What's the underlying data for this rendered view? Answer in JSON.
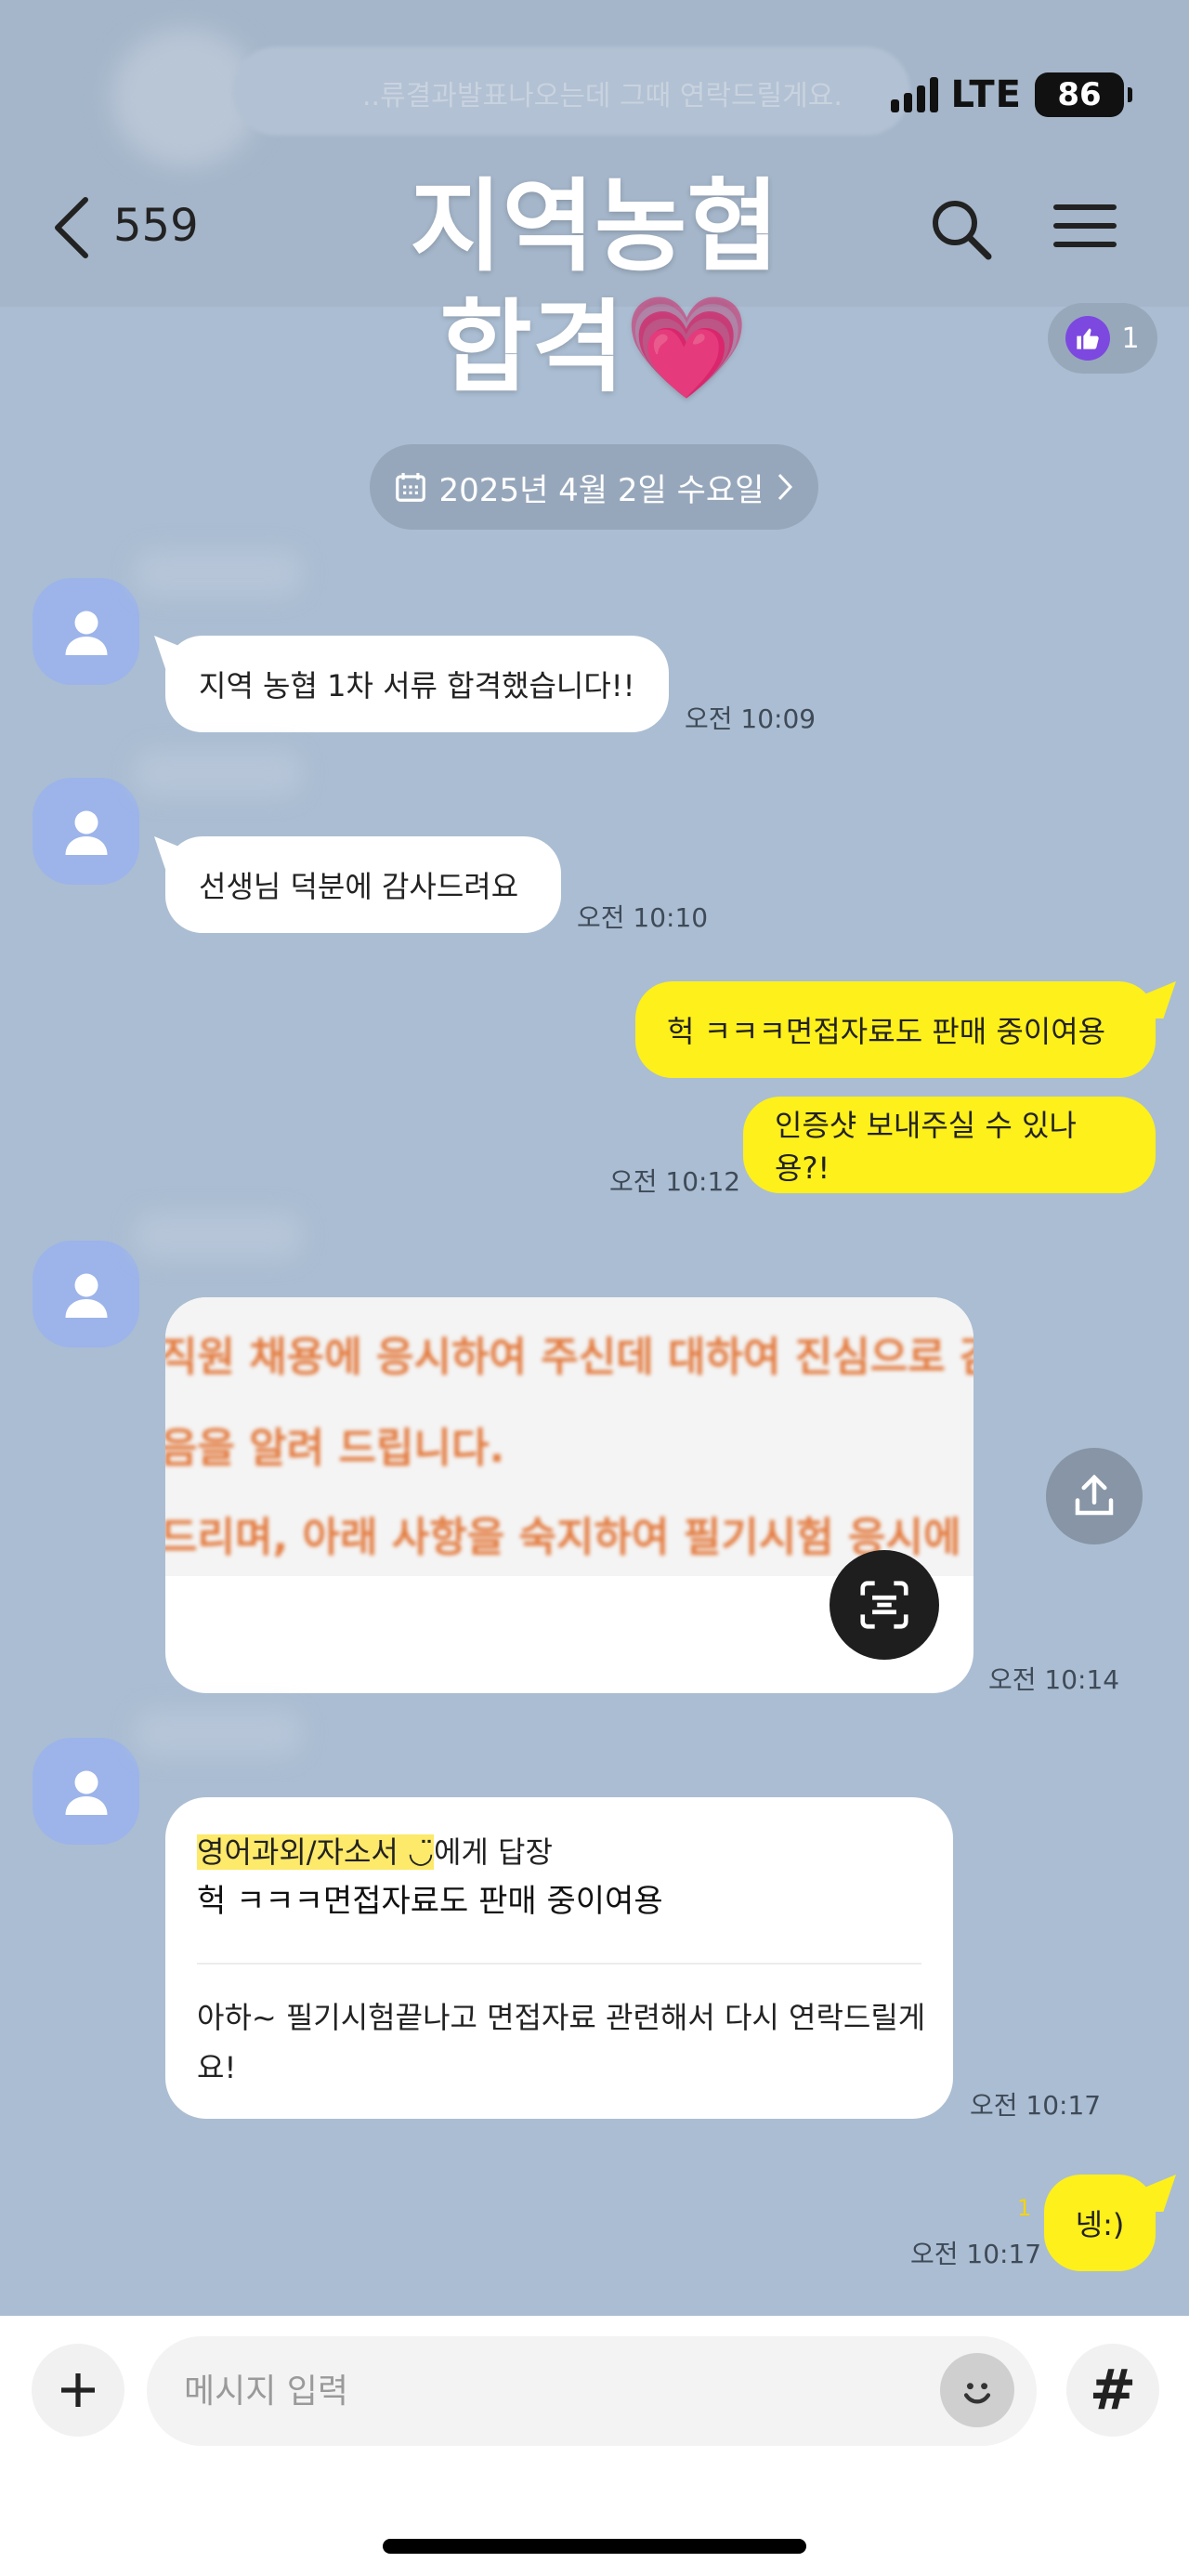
{
  "status_bar": {
    "network": "LTE",
    "battery": "86"
  },
  "pinned": {
    "text": "..류결과발표나오는데 그때 연락드릴게요."
  },
  "header": {
    "unread_count": "559"
  },
  "overlay": {
    "line1": "지역농협",
    "line2": "합격💗"
  },
  "like_badge": {
    "count": "1"
  },
  "date_pill": {
    "label": "2025년 4월 2일 수요일"
  },
  "messages": [
    {
      "side": "in",
      "text": "지역 농협 1차 서류 합격했습니다!!",
      "time": "오전 10:09"
    },
    {
      "side": "in",
      "text": "선생님 덕분에 감사드려요",
      "time": "오전 10:10"
    },
    {
      "side": "out",
      "text": "헉 ㅋㅋㅋ면접자료도 판매 중이여용",
      "time": ""
    },
    {
      "side": "out",
      "text": "인증샷 보내주실 수 있나용?!",
      "time": "오전 10:12"
    },
    {
      "side": "in",
      "type": "image",
      "time": "오전 10:14"
    },
    {
      "side": "out",
      "text": "넹:)",
      "time": "오전 10:17",
      "read": "1"
    }
  ],
  "image_message": {
    "lines": [
      "직원 채용에 응시하여 주신데 대하여 진심으로 감",
      "음을 알려 드립니다.",
      "드리며, 아래 사항을 숙지하여 필기시험 응시에"
    ]
  },
  "reply": {
    "target_highlight": "영어과외/자소서 ◡̈",
    "target_suffix": "에게 답장",
    "quoted": "헉 ㅋㅋㅋ면접자료도 판매 중이여용",
    "body": "아하~ 필기시험끝나고 면접자료 관련해서 다시 연락드릴게요!",
    "time": "오전 10:17"
  },
  "input": {
    "placeholder": "메시지 입력"
  },
  "colors": {
    "chat_bg": "#abbdd2",
    "outgoing": "#fef01b",
    "incoming": "#ffffff",
    "avatar": "#9cb4ea"
  },
  "icons": [
    "back-icon",
    "search-icon",
    "menu-icon",
    "thumbs-up-icon",
    "calendar-icon",
    "share-icon",
    "text-scan-icon",
    "plus-icon",
    "emoji-icon",
    "hash-icon"
  ]
}
